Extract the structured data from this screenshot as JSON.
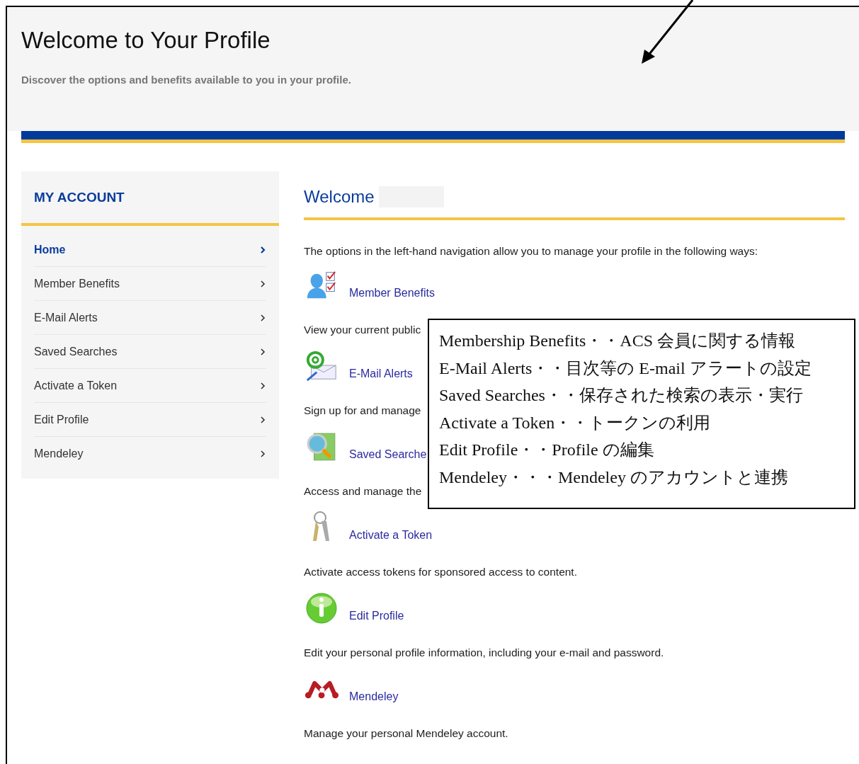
{
  "header": {
    "title": "Welcome to Your Profile",
    "subtitle": "Discover the options and benefits available to you in your profile."
  },
  "sidebar": {
    "title": "MY ACCOUNT",
    "items": [
      {
        "label": "Home",
        "selected": true
      },
      {
        "label": "Member Benefits",
        "selected": false
      },
      {
        "label": "E-Mail Alerts",
        "selected": false
      },
      {
        "label": "Saved Searches",
        "selected": false
      },
      {
        "label": "Activate a Token",
        "selected": false
      },
      {
        "label": "Edit Profile",
        "selected": false
      },
      {
        "label": "Mendeley",
        "selected": false
      }
    ]
  },
  "main": {
    "heading": "Welcome",
    "intro": "The options in the left-hand navigation allow you to manage your profile in the following ways:",
    "features": [
      {
        "title": "Member Benefits",
        "description": "View your current public"
      },
      {
        "title": "E-Mail Alerts",
        "description": "Sign up for and manage"
      },
      {
        "title": "Saved Searche",
        "description": "Access and manage the"
      },
      {
        "title": "Activate a Token",
        "description": "Activate access tokens for sponsored access to content."
      },
      {
        "title": "Edit Profile",
        "description": "Edit your personal profile information, including your e-mail and password."
      },
      {
        "title": "Mendeley",
        "description": "Manage your personal Mendeley account."
      }
    ]
  },
  "annotation": {
    "lines": [
      "Membership Benefits・・ACS 会員に関する情報",
      "E-Mail Alerts・・目次等の E-mail アラートの設定",
      "Saved Searches・・保存された検索の表示・実行",
      "Activate a Token・・トークンの利用",
      "Edit Profile・・Profile の編集",
      "Mendeley・・・Mendeley のアカウントと連携"
    ]
  }
}
